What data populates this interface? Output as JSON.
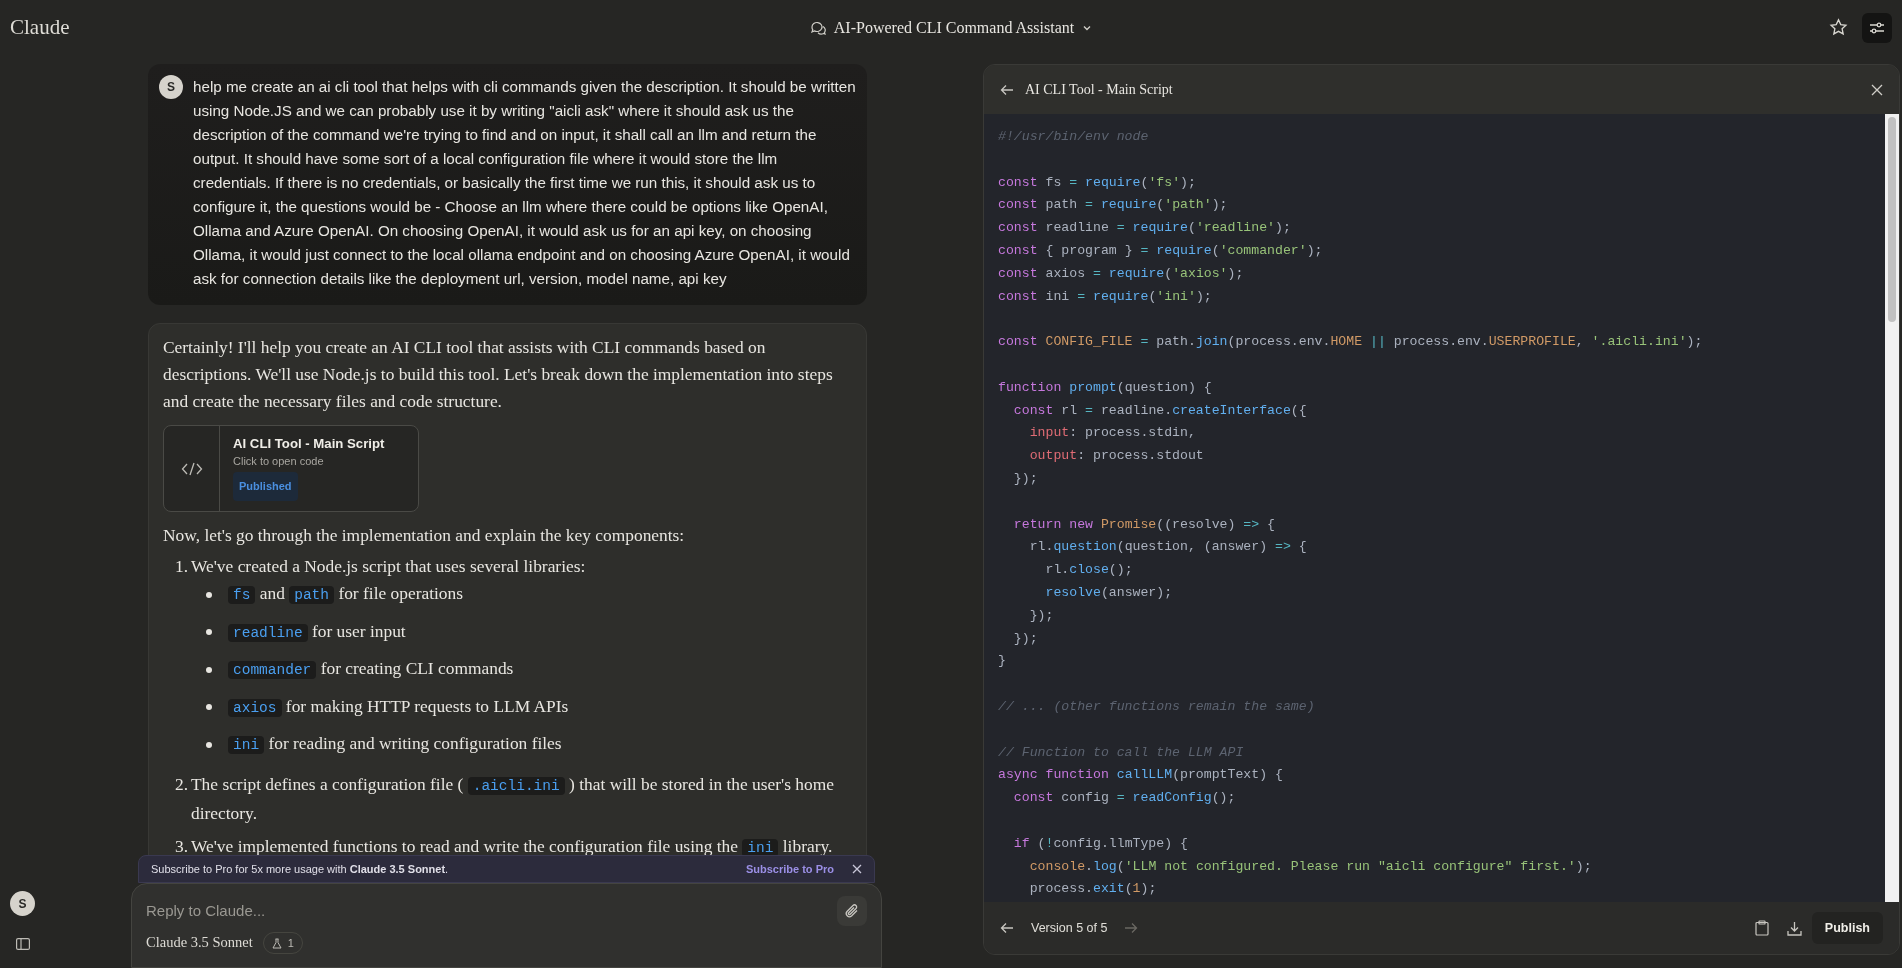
{
  "app": {
    "name": "Claude"
  },
  "header": {
    "title": "AI-Powered CLI Command Assistant"
  },
  "sidebar": {
    "avatar": "S"
  },
  "user_message": {
    "avatar": "S",
    "text": "help me create an ai cli tool that helps with cli commands given the description. It should be written using Node.JS and we can probably use it by writing \"aicli ask\" where it should ask us the description of the command we're trying to find and on input, it shall call an llm and return the output. It should have some sort of a local configuration file where it would store the llm credentials. If there is no credentials, or basically the first time we run this, it should ask us to configure it, the questions would be - Choose an llm where there could be options like OpenAI, Ollama and Azure OpenAI. On choosing OpenAI, it would ask us for an api key, on choosing Ollama, it would just connect to the local ollama endpoint and on choosing Azure OpenAI, it would ask for connection details like the deployment url, version, model name, api key"
  },
  "assistant_message": {
    "intro": "Certainly! I'll help you create an AI CLI tool that assists with CLI commands based on descriptions. We'll use Node.js to build this tool. Let's break down the implementation into steps and create the necessary files and code structure.",
    "artifact": {
      "title": "AI CLI Tool - Main Script",
      "subtitle": "Click to open code",
      "badge": "Published"
    },
    "lead": "Now, let's go through the implementation and explain the key components:",
    "steps": [
      {
        "number": "1.",
        "parts": [
          {
            "kind": "text",
            "text": "We've created a Node.js script that uses several libraries:"
          }
        ],
        "children": [
          {
            "parts": [
              {
                "kind": "code",
                "text": "fs"
              },
              {
                "kind": "text",
                "text": " and "
              },
              {
                "kind": "code",
                "text": "path"
              },
              {
                "kind": "text",
                "text": " for file operations"
              }
            ]
          },
          {
            "parts": [
              {
                "kind": "code",
                "text": "readline"
              },
              {
                "kind": "text",
                "text": " for user input"
              }
            ]
          },
          {
            "parts": [
              {
                "kind": "code",
                "text": "commander"
              },
              {
                "kind": "text",
                "text": " for creating CLI commands"
              }
            ]
          },
          {
            "parts": [
              {
                "kind": "code",
                "text": "axios"
              },
              {
                "kind": "text",
                "text": " for making HTTP requests to LLM APIs"
              }
            ]
          },
          {
            "parts": [
              {
                "kind": "code",
                "text": "ini"
              },
              {
                "kind": "text",
                "text": " for reading and writing configuration files"
              }
            ]
          }
        ]
      },
      {
        "number": "2.",
        "parts": [
          {
            "kind": "text",
            "text": "The script defines a configuration file ( "
          },
          {
            "kind": "code",
            "text": ".aicli.ini"
          },
          {
            "kind": "text",
            "text": " ) that will be stored in the user's home directory."
          }
        ]
      },
      {
        "number": "3.",
        "parts": [
          {
            "kind": "text",
            "text": "We've implemented functions to read and write the configuration file using the "
          },
          {
            "kind": "code",
            "text": "ini"
          },
          {
            "kind": "text",
            "text": " library."
          }
        ]
      }
    ]
  },
  "banner": {
    "text": "Subscribe to Pro for 5x more usage with **Claude 3.5 Sonnet**.",
    "action": "Subscribe to Pro"
  },
  "composer": {
    "placeholder": "Reply to Claude...",
    "model": "Claude 3.5 Sonnet",
    "badge": "1"
  },
  "panel": {
    "title": "AI CLI Tool - Main Script",
    "version": "Version 5 of 5",
    "prev_disabled": false,
    "next_disabled": true,
    "publish": "Publish",
    "code": [
      {
        "tokens": [
          {
            "kind": "comment",
            "text": "#!/usr/bin/env node"
          }
        ]
      },
      {
        "space_before": true,
        "tokens": [
          {
            "kind": "keyword",
            "text": "const"
          },
          {
            "kind": "plain",
            "text": " fs "
          },
          {
            "kind": "operator",
            "text": "="
          },
          {
            "kind": "function",
            "text": " require"
          },
          {
            "kind": "plain",
            "text": "("
          },
          {
            "kind": "string",
            "text": "'fs'"
          },
          {
            "kind": "plain",
            "text": ");"
          }
        ]
      },
      {
        "tokens": [
          {
            "kind": "keyword",
            "text": "const"
          },
          {
            "kind": "plain",
            "text": " path "
          },
          {
            "kind": "operator",
            "text": "="
          },
          {
            "kind": "function",
            "text": " require"
          },
          {
            "kind": "plain",
            "text": "("
          },
          {
            "kind": "string",
            "text": "'path'"
          },
          {
            "kind": "plain",
            "text": ");"
          }
        ]
      },
      {
        "tokens": [
          {
            "kind": "keyword",
            "text": "const"
          },
          {
            "kind": "plain",
            "text": " readline "
          },
          {
            "kind": "operator",
            "text": "="
          },
          {
            "kind": "function",
            "text": " require"
          },
          {
            "kind": "plain",
            "text": "("
          },
          {
            "kind": "string",
            "text": "'readline'"
          },
          {
            "kind": "plain",
            "text": ");"
          }
        ]
      },
      {
        "tokens": [
          {
            "kind": "keyword",
            "text": "const"
          },
          {
            "kind": "plain",
            "text": " { program } "
          },
          {
            "kind": "operator",
            "text": "="
          },
          {
            "kind": "function",
            "text": " require"
          },
          {
            "kind": "plain",
            "text": "("
          },
          {
            "kind": "string",
            "text": "'commander'"
          },
          {
            "kind": "plain",
            "text": ");"
          }
        ]
      },
      {
        "tokens": [
          {
            "kind": "keyword",
            "text": "const"
          },
          {
            "kind": "plain",
            "text": " axios "
          },
          {
            "kind": "operator",
            "text": "="
          },
          {
            "kind": "function",
            "text": " require"
          },
          {
            "kind": "plain",
            "text": "("
          },
          {
            "kind": "string",
            "text": "'axios'"
          },
          {
            "kind": "plain",
            "text": ");"
          }
        ]
      },
      {
        "tokens": [
          {
            "kind": "keyword",
            "text": "const"
          },
          {
            "kind": "plain",
            "text": " ini "
          },
          {
            "kind": "operator",
            "text": "="
          },
          {
            "kind": "function",
            "text": " require"
          },
          {
            "kind": "plain",
            "text": "("
          },
          {
            "kind": "string",
            "text": "'ini'"
          },
          {
            "kind": "plain",
            "text": ");"
          }
        ]
      },
      {
        "space_before": true,
        "tokens": [
          {
            "kind": "keyword",
            "text": "const "
          },
          {
            "kind": "constant",
            "text": "CONFIG_FILE"
          },
          {
            "kind": "operator",
            "text": " = "
          },
          {
            "kind": "plain",
            "text": "path."
          },
          {
            "kind": "function",
            "text": "join"
          },
          {
            "kind": "plain",
            "text": "(process.env."
          },
          {
            "kind": "constant",
            "text": "HOME"
          },
          {
            "kind": "operator",
            "text": " || "
          },
          {
            "kind": "plain",
            "text": "process.env."
          },
          {
            "kind": "constant",
            "text": "USERPROFILE"
          },
          {
            "kind": "plain",
            "text": ", "
          },
          {
            "kind": "string",
            "text": "'.aicli.ini'"
          },
          {
            "kind": "plain",
            "text": ");"
          }
        ]
      },
      {
        "space_before": true,
        "tokens": [
          {
            "kind": "keyword",
            "text": "function "
          },
          {
            "kind": "function",
            "text": "prompt"
          },
          {
            "kind": "plain",
            "text": "(question) {"
          }
        ]
      },
      {
        "tokens": [
          {
            "kind": "keyword",
            "text": "  const"
          },
          {
            "kind": "plain",
            "text": " rl "
          },
          {
            "kind": "operator",
            "text": "="
          },
          {
            "kind": "plain",
            "text": " readline."
          },
          {
            "kind": "function",
            "text": "createInterface"
          },
          {
            "kind": "plain",
            "text": "({"
          }
        ]
      },
      {
        "tokens": [
          {
            "kind": "property",
            "text": "    input"
          },
          {
            "kind": "plain",
            "text": ": process.stdin,"
          }
        ]
      },
      {
        "tokens": [
          {
            "kind": "property",
            "text": "    output"
          },
          {
            "kind": "plain",
            "text": ": process.stdout"
          }
        ]
      },
      {
        "tokens": [
          {
            "kind": "plain",
            "text": "  });"
          }
        ]
      },
      {
        "space_before": true,
        "tokens": [
          {
            "kind": "keyword",
            "text": "  return new "
          },
          {
            "kind": "constant",
            "text": "Promise"
          },
          {
            "kind": "plain",
            "text": "((resolve) "
          },
          {
            "kind": "operator",
            "text": "=>"
          },
          {
            "kind": "plain",
            "text": " {"
          }
        ]
      },
      {
        "tokens": [
          {
            "kind": "plain",
            "text": "    rl."
          },
          {
            "kind": "function",
            "text": "question"
          },
          {
            "kind": "plain",
            "text": "(question, (answer) "
          },
          {
            "kind": "operator",
            "text": "=>"
          },
          {
            "kind": "plain",
            "text": " {"
          }
        ]
      },
      {
        "tokens": [
          {
            "kind": "plain",
            "text": "      rl."
          },
          {
            "kind": "function",
            "text": "close"
          },
          {
            "kind": "plain",
            "text": "();"
          }
        ]
      },
      {
        "tokens": [
          {
            "kind": "function",
            "text": "      resolve"
          },
          {
            "kind": "plain",
            "text": "(answer);"
          }
        ]
      },
      {
        "tokens": [
          {
            "kind": "plain",
            "text": "    });"
          }
        ]
      },
      {
        "tokens": [
          {
            "kind": "plain",
            "text": "  });"
          }
        ]
      },
      {
        "tokens": [
          {
            "kind": "plain",
            "text": "}"
          }
        ]
      },
      {
        "space_before": true,
        "tokens": [
          {
            "kind": "comment",
            "text": "// ... (other functions remain the same)"
          }
        ]
      },
      {
        "space_before": true,
        "tokens": [
          {
            "kind": "comment",
            "text": "// Function to call the LLM API"
          }
        ]
      },
      {
        "tokens": [
          {
            "kind": "keyword",
            "text": "async function "
          },
          {
            "kind": "function",
            "text": "callLLM"
          },
          {
            "kind": "plain",
            "text": "(promptText) {"
          }
        ]
      },
      {
        "tokens": [
          {
            "kind": "keyword",
            "text": "  const"
          },
          {
            "kind": "plain",
            "text": " config "
          },
          {
            "kind": "operator",
            "text": "="
          },
          {
            "kind": "function",
            "text": " readConfig"
          },
          {
            "kind": "plain",
            "text": "();"
          }
        ]
      },
      {
        "space_before": true,
        "tokens": [
          {
            "kind": "keyword",
            "text": "  if"
          },
          {
            "kind": "plain",
            "text": " ("
          },
          {
            "kind": "operator",
            "text": "!"
          },
          {
            "kind": "plain",
            "text": "config.llmType) {"
          }
        ]
      },
      {
        "tokens": [
          {
            "kind": "constant",
            "text": "    console"
          },
          {
            "kind": "plain",
            "text": "."
          },
          {
            "kind": "function",
            "text": "log"
          },
          {
            "kind": "plain",
            "text": "("
          },
          {
            "kind": "string",
            "text": "'LLM not configured. Please run \"aicli configure\" first.'"
          },
          {
            "kind": "plain",
            "text": ");"
          }
        ]
      },
      {
        "tokens": [
          {
            "kind": "plain",
            "text": "    process."
          },
          {
            "kind": "function",
            "text": "exit"
          },
          {
            "kind": "plain",
            "text": "("
          },
          {
            "kind": "constant",
            "text": "1"
          },
          {
            "kind": "plain",
            "text": ");"
          }
        ]
      }
    ]
  }
}
